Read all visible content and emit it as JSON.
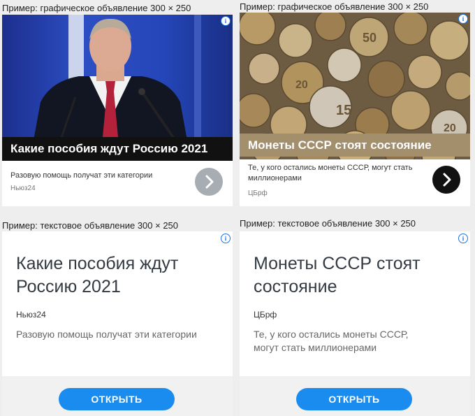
{
  "ads": [
    {
      "caption": "Пример: графическое объявление 300 × 250",
      "type": "image",
      "headline": "Какие пособия ждут Россию 2021",
      "description": "Разовую помощь получат эти категории",
      "source": "Ньюз24",
      "colors": {
        "bar": "#111111",
        "button": "#a8acb3",
        "image_bg": "#1f3fa8"
      }
    },
    {
      "caption": "Пример: графическое объявление 300 × 250",
      "type": "image",
      "headline": "Монеты СССР стоят состояние",
      "description": "Те, у кого остались монеты СССР, могут стать миллионерами",
      "source": "ЦБрф",
      "colors": {
        "bar": "#a38f6c",
        "button": "#111111",
        "image_bg": "#8a7858"
      }
    },
    {
      "caption": "Пример: текстовое объявление 300 × 250",
      "type": "text",
      "headline": "Какие пособия ждут Россию 2021",
      "source": "Ньюз24",
      "description": "Разовую помощь получат эти категории",
      "button_label": "ОТКРЫТЬ"
    },
    {
      "caption": "Пример: текстовое объявление 300 × 250",
      "type": "text",
      "headline": "Монеты СССР стоят состояние",
      "source": "ЦБрф",
      "description": "Те, у кого остались монеты СССР, могут стать миллионерами",
      "button_label": "ОТКРЫТЬ"
    }
  ],
  "icons": {
    "info": "i",
    "chevron": "chevron-right-icon"
  },
  "accent_color": "#1a8cf0"
}
